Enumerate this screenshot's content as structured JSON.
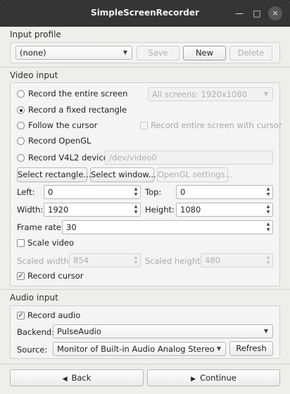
{
  "window": {
    "title": "SimpleScreenRecorder",
    "controls": [
      "—",
      "□",
      "×"
    ]
  },
  "input_profile": {
    "section": "Input profile",
    "profile_value": "(none)",
    "save_label": "Save",
    "new_label": "New",
    "delete_label": "Delete"
  },
  "video_input": {
    "section": "Video input",
    "options": {
      "entire_screen": "Record the entire screen",
      "fixed_rect": "Record a fixed rectangle",
      "follow_cursor": "Follow the cursor",
      "opengl": "Record OpenGL",
      "v4l2": "Record V4L2 device"
    },
    "selected_option": "Record a fixed rectangle",
    "screens_value": "All screens: 1920x1080",
    "entire_screen_cursor_label": "Record entire screen with cursor",
    "v4l2_device_value": "/dev/video0",
    "select_rect_label": "Select rectangle...",
    "select_window_label": "Select window...",
    "opengl_settings_label": "OpenGL settings...",
    "left_label": "Left:",
    "left_value": "0",
    "top_label": "Top:",
    "top_value": "0",
    "width_label": "Width:",
    "width_value": "1920",
    "height_label": "Height:",
    "height_value": "1080",
    "frame_rate_label": "Frame rate:",
    "frame_rate_value": "30",
    "scale_video_label": "Scale video",
    "scaled_width_label": "Scaled width:",
    "scaled_width_value": "854",
    "scaled_height_label": "Scaled height:",
    "scaled_height_value": "480",
    "record_cursor_label": "Record cursor"
  },
  "audio_input": {
    "section": "Audio input",
    "record_audio_label": "Record audio",
    "backend_label": "Backend:",
    "backend_value": "PulseAudio",
    "source_label": "Source:",
    "source_value": "Monitor of Built-in Audio Analog Stereo",
    "refresh_label": "Refresh"
  },
  "footer": {
    "back_label": "Back",
    "back_icon": "◀",
    "continue_label": "Continue",
    "continue_icon": "▶"
  }
}
